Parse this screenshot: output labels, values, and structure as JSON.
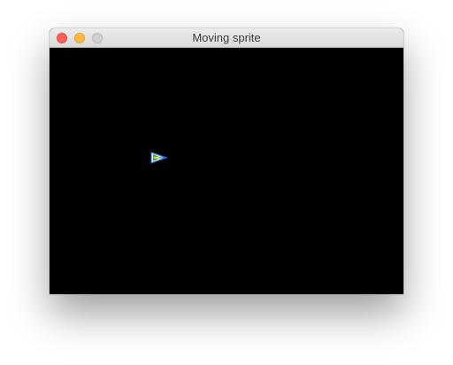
{
  "window": {
    "title": "Moving sprite",
    "controls": {
      "close": "close-icon",
      "minimize": "minimize-icon",
      "zoom": "zoom-icon"
    }
  },
  "canvas": {
    "background": "#000000",
    "sprite": {
      "icon": "spaceship-sprite",
      "colors": [
        "#ffffff",
        "#2a6fd6",
        "#3aa84a",
        "#e8d84a"
      ]
    }
  }
}
